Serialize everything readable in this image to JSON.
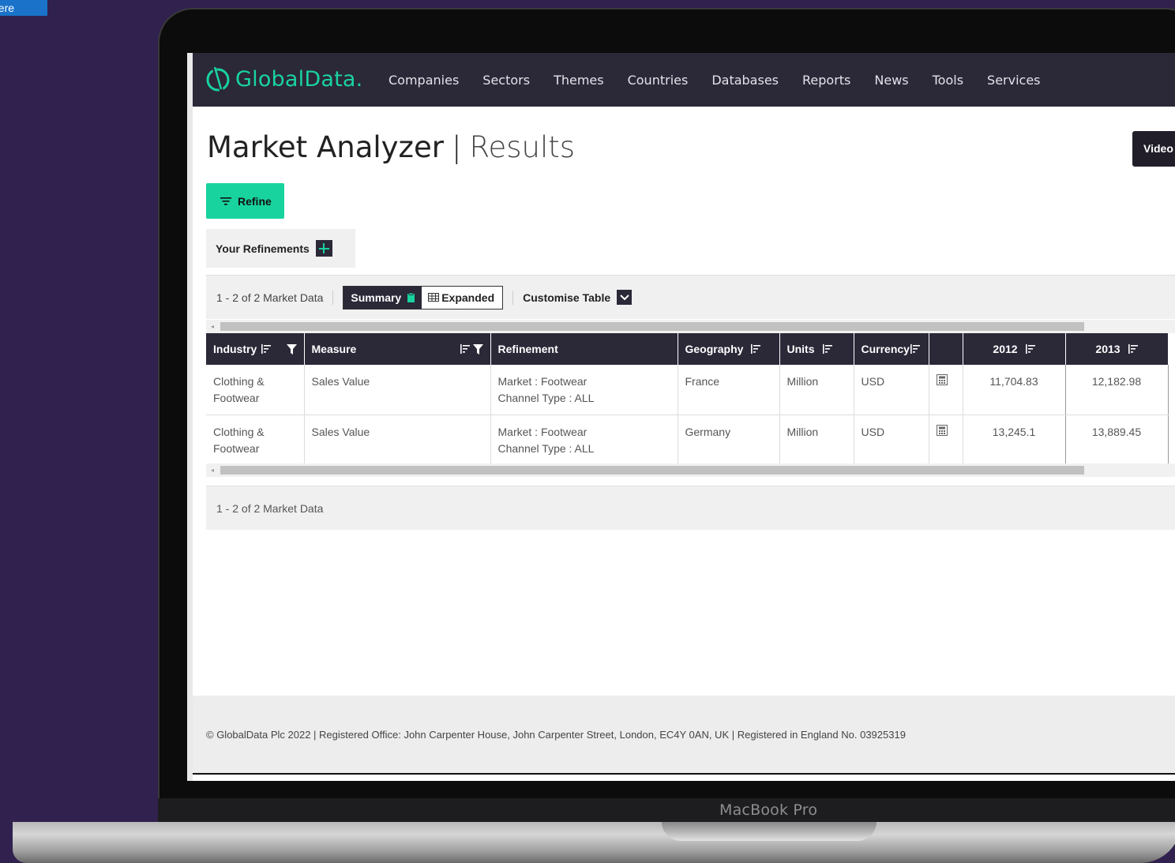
{
  "skip_link": "here",
  "device_label": "MacBook Pro",
  "brand": {
    "name": "GlobalData.",
    "accent_color": "#18d39e",
    "nav_bg": "#2b2838"
  },
  "nav": [
    "Companies",
    "Sectors",
    "Themes",
    "Countries",
    "Databases",
    "Reports",
    "News",
    "Tools",
    "Services"
  ],
  "page": {
    "title": "Market Analyzer",
    "separator": "|",
    "subtitle": "Results",
    "video_label": "Video"
  },
  "refine_label": "Refine",
  "refinements_label": "Your Refinements",
  "toolbar": {
    "count": "1 - 2 of 2 Market Data",
    "summary_label": "Summary",
    "expanded_label": "Expanded",
    "customise_label": "Customise Table"
  },
  "table": {
    "columns": [
      "Industry",
      "Measure",
      "Refinement",
      "Geography",
      "Units",
      "Currency",
      "",
      "2012",
      "2013"
    ],
    "rows": [
      {
        "industry": "Clothing & Footwear",
        "measure": "Sales Value",
        "refinement_market": "Market : Footwear",
        "refinement_channel": "Channel Type : ALL",
        "geography": "France",
        "units": "Million",
        "currency": "USD",
        "y2012": "11,704.83",
        "y2013": "12,182.98"
      },
      {
        "industry": "Clothing & Footwear",
        "measure": "Sales Value",
        "refinement_market": "Market : Footwear",
        "refinement_channel": "Channel Type : ALL",
        "geography": "Germany",
        "units": "Million",
        "currency": "USD",
        "y2012": "13,245.1",
        "y2013": "13,889.45"
      }
    ]
  },
  "footer_count": "1 - 2 of 2 Market Data",
  "copyright": "© GlobalData Plc 2022 | Registered Office: John Carpenter House, John Carpenter Street, London, EC4Y 0AN, UK | Registered in England No. 03925319"
}
